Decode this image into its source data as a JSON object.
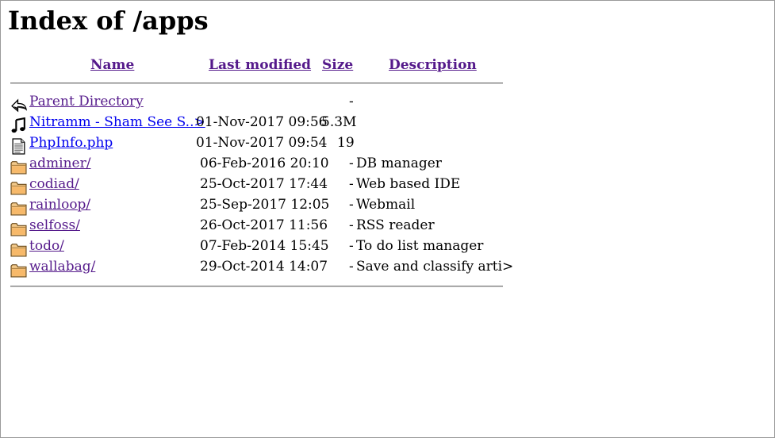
{
  "page": {
    "title": "Index of /apps"
  },
  "columns": {
    "name": "Name",
    "last_modified": "Last modified",
    "size": "Size",
    "description": "Description"
  },
  "rows": [
    {
      "icon": "back-arrow-icon",
      "name": "Parent Directory",
      "date": "",
      "size": "-",
      "desc": "",
      "visited": true
    },
    {
      "icon": "music-note-icon",
      "name": "Nitramm - Sham See S..>",
      "date": "01-Nov-2017 09:56",
      "size": "5.3M",
      "desc": "",
      "visited": false
    },
    {
      "icon": "text-file-icon",
      "name": "PhpInfo.php",
      "date": "01-Nov-2017 09:54",
      "size": "19",
      "desc": "",
      "visited": false
    },
    {
      "icon": "folder-icon",
      "name": "adminer/",
      "date": "06-Feb-2016 20:10",
      "size": "-",
      "desc": "DB manager",
      "visited": true
    },
    {
      "icon": "folder-icon",
      "name": "codiad/",
      "date": "25-Oct-2017 17:44",
      "size": "-",
      "desc": "Web based IDE",
      "visited": true
    },
    {
      "icon": "folder-icon",
      "name": "rainloop/",
      "date": "25-Sep-2017 12:05",
      "size": "-",
      "desc": "Webmail",
      "visited": true
    },
    {
      "icon": "folder-icon",
      "name": "selfoss/",
      "date": "26-Oct-2017 11:56",
      "size": "-",
      "desc": "RSS reader",
      "visited": true
    },
    {
      "icon": "folder-icon",
      "name": "todo/",
      "date": "07-Feb-2014 15:45",
      "size": "-",
      "desc": "To do list manager",
      "visited": true
    },
    {
      "icon": "folder-icon",
      "name": "wallabag/",
      "date": "29-Oct-2014 14:07",
      "size": "-",
      "desc": "Save and classify arti>",
      "visited": true
    }
  ]
}
